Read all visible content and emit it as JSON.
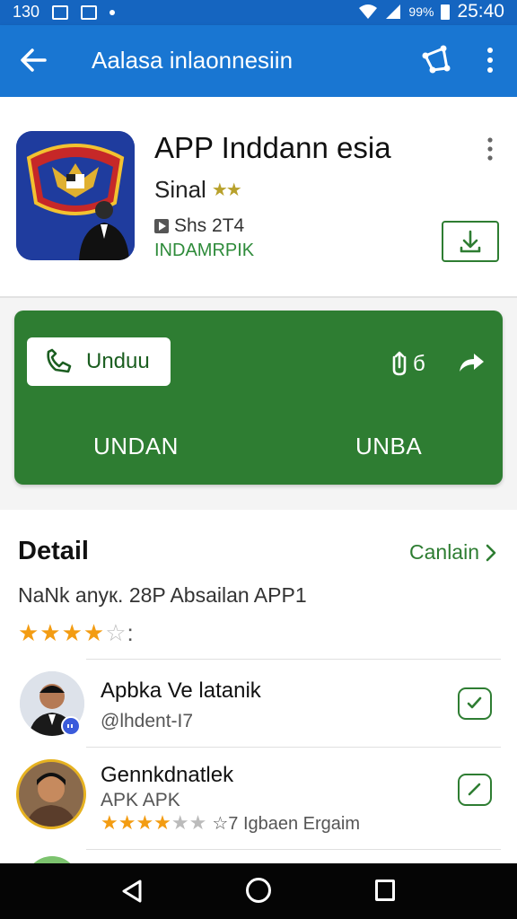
{
  "status_bar": {
    "left_text": "130",
    "battery_pct": "99%",
    "time": "25:40"
  },
  "app_bar": {
    "title": "Aalasa inlaonnesiin"
  },
  "app": {
    "name": "APP Inddann esia",
    "subtitle": "Sinal",
    "stars_small": "★★",
    "size": "Shs 2T4",
    "developer": "INDAMRPIK"
  },
  "actions": {
    "unduh_label": "Unduu",
    "count_label": "б",
    "left_label": "UNDAN",
    "right_label": "UNBA"
  },
  "detail": {
    "title": "Detail",
    "link_label": "Canlain",
    "description": "NaNk anyк. 28P Absailan APP1",
    "stars": "★★★★",
    "stars_empty": "☆",
    "stars_suffix": ":"
  },
  "list": [
    {
      "name": "Apbka Ve latanik",
      "sub": "@lhdent-I7"
    },
    {
      "name": "Gennkdnatlek",
      "sub": "APK APK",
      "stars_filled": "★★★★",
      "stars_empty": "★★",
      "rating_text": "☆7 Igbaen Ergaim"
    }
  ]
}
